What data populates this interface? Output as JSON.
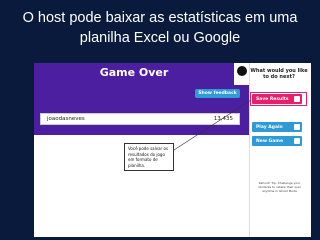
{
  "slide": {
    "title": "O host pode baixar as estatísticas em uma planilha Excel ou Google"
  },
  "game": {
    "banner_title": "Game Over",
    "show_feedback_label": "Show feedback",
    "player": {
      "name": "joaodasneves",
      "score": "13,435"
    },
    "tooltip_text": "Você pode salvar os resultados do jogo em formato de planilha."
  },
  "sidebar": {
    "heading": "What would you like to do next?",
    "buttons": [
      {
        "label": "Save Results"
      },
      {
        "label": "Play Again"
      },
      {
        "label": "New Game"
      }
    ],
    "tip": "Kahoot! Tip: Challenge your students to retake their quiz anytime in Ghost Mode"
  },
  "colors": {
    "slide_bg": "#0a1a3c",
    "brand_purple": "#4b1fa0",
    "save_pink": "#e6206b",
    "action_blue": "#2f9bd6"
  }
}
